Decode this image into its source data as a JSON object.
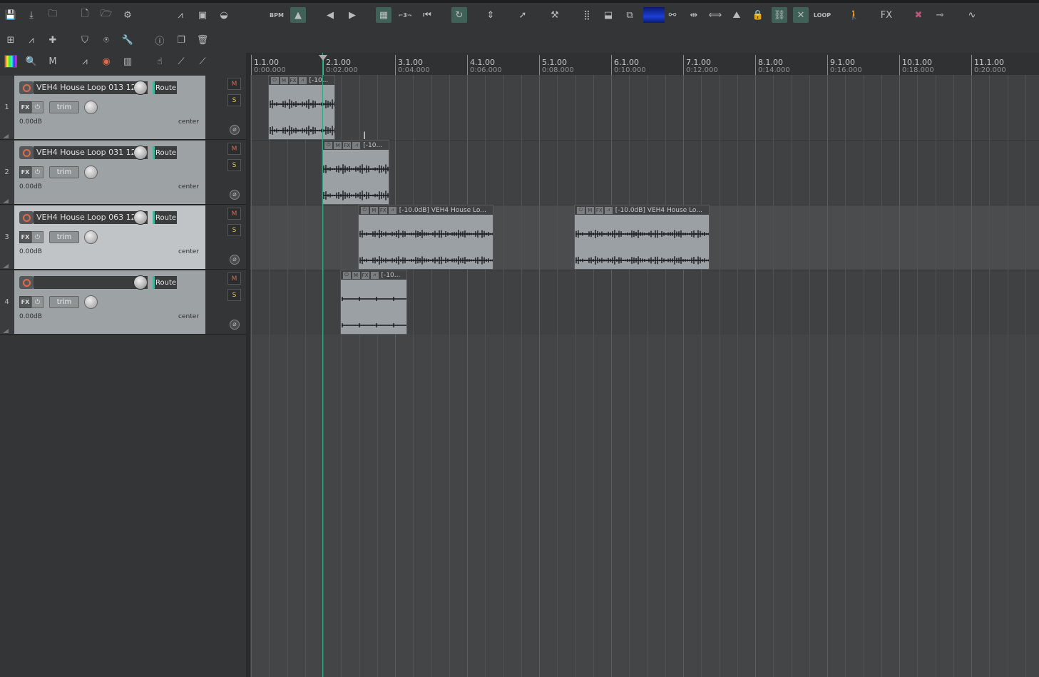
{
  "toolbar_main": [
    {
      "name": "save-icon",
      "glyph": "💾"
    },
    {
      "name": "save-as-icon",
      "glyph": "⤓"
    },
    {
      "name": "open-project-icon",
      "glyph": "🗀"
    },
    {
      "name": "new-project-icon",
      "glyph": "🗋"
    },
    {
      "name": "open-folder-icon",
      "glyph": "🗁"
    },
    {
      "name": "project-settings-icon",
      "glyph": "⚙"
    },
    {
      "name": "envelope-icon",
      "glyph": "⩘"
    },
    {
      "name": "render-icon",
      "glyph": "▣"
    },
    {
      "name": "metronome-drum-icon",
      "glyph": "◒"
    },
    {
      "name": "tempo-bpm-icon",
      "glyph": "BPM"
    },
    {
      "name": "metronome-icon",
      "glyph": "▲"
    },
    {
      "name": "prev-icon",
      "glyph": "◀"
    },
    {
      "name": "next-icon",
      "glyph": "▶"
    },
    {
      "name": "grid-icon",
      "glyph": "▦"
    },
    {
      "name": "triplet-icon",
      "glyph": "⌐3¬"
    },
    {
      "name": "rewind-marker-icon",
      "glyph": "⏮"
    },
    {
      "name": "loop-icon",
      "glyph": "↻"
    },
    {
      "name": "zoom-icon",
      "glyph": "⇕"
    },
    {
      "name": "pointer-icon",
      "glyph": "➚"
    },
    {
      "name": "hammer-icon",
      "glyph": "⚒"
    },
    {
      "name": "snap-grid-icon",
      "glyph": "⣿"
    },
    {
      "name": "ripple-icon",
      "glyph": "⬓"
    },
    {
      "name": "group-icon",
      "glyph": "⧉"
    },
    {
      "name": "color-bar-icon",
      "glyph": ""
    },
    {
      "name": "link-icon",
      "glyph": "⚯"
    },
    {
      "name": "crossfade-icon",
      "glyph": "⇹"
    },
    {
      "name": "split-icon",
      "glyph": "⟺"
    },
    {
      "name": "marker-icon",
      "glyph": "⛰"
    },
    {
      "name": "lock-icon",
      "glyph": "🔒"
    },
    {
      "name": "chain-icon",
      "glyph": "⛓"
    },
    {
      "name": "envelope-follow-icon",
      "glyph": "✕"
    },
    {
      "name": "loop-points-icon",
      "glyph": "LOOP"
    },
    {
      "name": "walk-icon",
      "glyph": "🚶"
    },
    {
      "name": "fx-icon",
      "glyph": "FX"
    },
    {
      "name": "bypass-icon",
      "glyph": "✖"
    },
    {
      "name": "plug-icon",
      "glyph": "⊸"
    },
    {
      "name": "headphone-icon",
      "glyph": "∿"
    }
  ],
  "toolbar_row2": [
    {
      "name": "route-matrix-icon",
      "glyph": "⊞"
    },
    {
      "name": "envelope-tool-icon",
      "glyph": "⩘"
    },
    {
      "name": "add-icon",
      "glyph": "✚"
    },
    {
      "name": "shield-icon",
      "glyph": "⛉"
    },
    {
      "name": "monitor-icon",
      "glyph": "⍟"
    },
    {
      "name": "wrench-icon",
      "glyph": "🔧"
    },
    {
      "name": "info-icon",
      "glyph": "ⓘ"
    },
    {
      "name": "copy-icon",
      "glyph": "❐"
    },
    {
      "name": "trash-icon",
      "glyph": "🗑"
    }
  ],
  "toolbar_row3": [
    {
      "name": "color-icon",
      "glyph": ""
    },
    {
      "name": "zoom-search-icon",
      "glyph": "🔍"
    },
    {
      "name": "midi-icon",
      "glyph": "M"
    },
    {
      "name": "envelope-arm-icon",
      "glyph": "⩘"
    },
    {
      "name": "record-arm-icon",
      "glyph": "◉"
    },
    {
      "name": "mixer-icon",
      "glyph": "▥"
    },
    {
      "name": "touch-icon",
      "glyph": "☝"
    },
    {
      "name": "automation-icon",
      "glyph": "⟋"
    },
    {
      "name": "automation-hand-icon",
      "glyph": "⟋"
    }
  ],
  "ruler": [
    {
      "bar": "1.1.00",
      "time": "0:00.000"
    },
    {
      "bar": "2.1.00",
      "time": "0:02.000"
    },
    {
      "bar": "3.1.00",
      "time": "0:04.000"
    },
    {
      "bar": "4.1.00",
      "time": "0:06.000"
    },
    {
      "bar": "5.1.00",
      "time": "0:08.000"
    },
    {
      "bar": "6.1.00",
      "time": "0:10.000"
    },
    {
      "bar": "7.1.00",
      "time": "0:12.000"
    },
    {
      "bar": "8.1.00",
      "time": "0:14.000"
    },
    {
      "bar": "9.1.00",
      "time": "0:16.000"
    },
    {
      "bar": "10.1.00",
      "time": "0:18.000"
    },
    {
      "bar": "11.1.00",
      "time": "0:20.000"
    }
  ],
  "tracks": [
    {
      "num": "1",
      "name": "VEH4 House Loop 013 12",
      "volume": "0.00dB",
      "pan": "center",
      "selected": false,
      "route": "Route",
      "fx": "FX",
      "trim": "trim",
      "mute": "M",
      "solo": "S",
      "phase": "⌀"
    },
    {
      "num": "2",
      "name": "VEH4 House Loop 031 12",
      "volume": "0.00dB",
      "pan": "center",
      "selected": false,
      "route": "Route",
      "fx": "FX",
      "trim": "trim",
      "mute": "M",
      "solo": "S",
      "phase": "⌀"
    },
    {
      "num": "3",
      "name": "VEH4 House Loop 063 12",
      "volume": "0.00dB",
      "pan": "center",
      "selected": true,
      "route": "Route",
      "fx": "FX",
      "trim": "trim",
      "mute": "M",
      "solo": "S",
      "phase": "⌀"
    },
    {
      "num": "4",
      "name": "",
      "volume": "0.00dB",
      "pan": "center",
      "selected": false,
      "route": "Route",
      "fx": "FX",
      "trim": "trim",
      "mute": "M",
      "solo": "S",
      "phase": "⌀"
    }
  ],
  "items": [
    {
      "track": 1,
      "start_beat": 0.5,
      "len_beats": 1.88,
      "label": "[-10...",
      "style": "dense"
    },
    {
      "track": 2,
      "start_beat": 2.0,
      "len_beats": 1.88,
      "label": "[-10...",
      "style": "dense"
    },
    {
      "track": 3,
      "start_beat": 3.0,
      "len_beats": 3.77,
      "label": "[-10.0dB] VEH4 House Lo...",
      "style": "long"
    },
    {
      "track": 3,
      "start_beat": 9.0,
      "len_beats": 3.77,
      "label": "[-10.0dB] VEH4 House Lo...",
      "style": "long"
    },
    {
      "track": 4,
      "start_beat": 2.5,
      "len_beats": 1.88,
      "label": "[-10...",
      "style": "sparse"
    }
  ],
  "item_header_buttons": [
    "⏻",
    "M",
    "FX",
    "⩘"
  ],
  "colors": {
    "accent": "#43b59a",
    "playcursor": "#2aa880",
    "record": "#e06a4a",
    "item_bg": "#9aa0a3"
  }
}
